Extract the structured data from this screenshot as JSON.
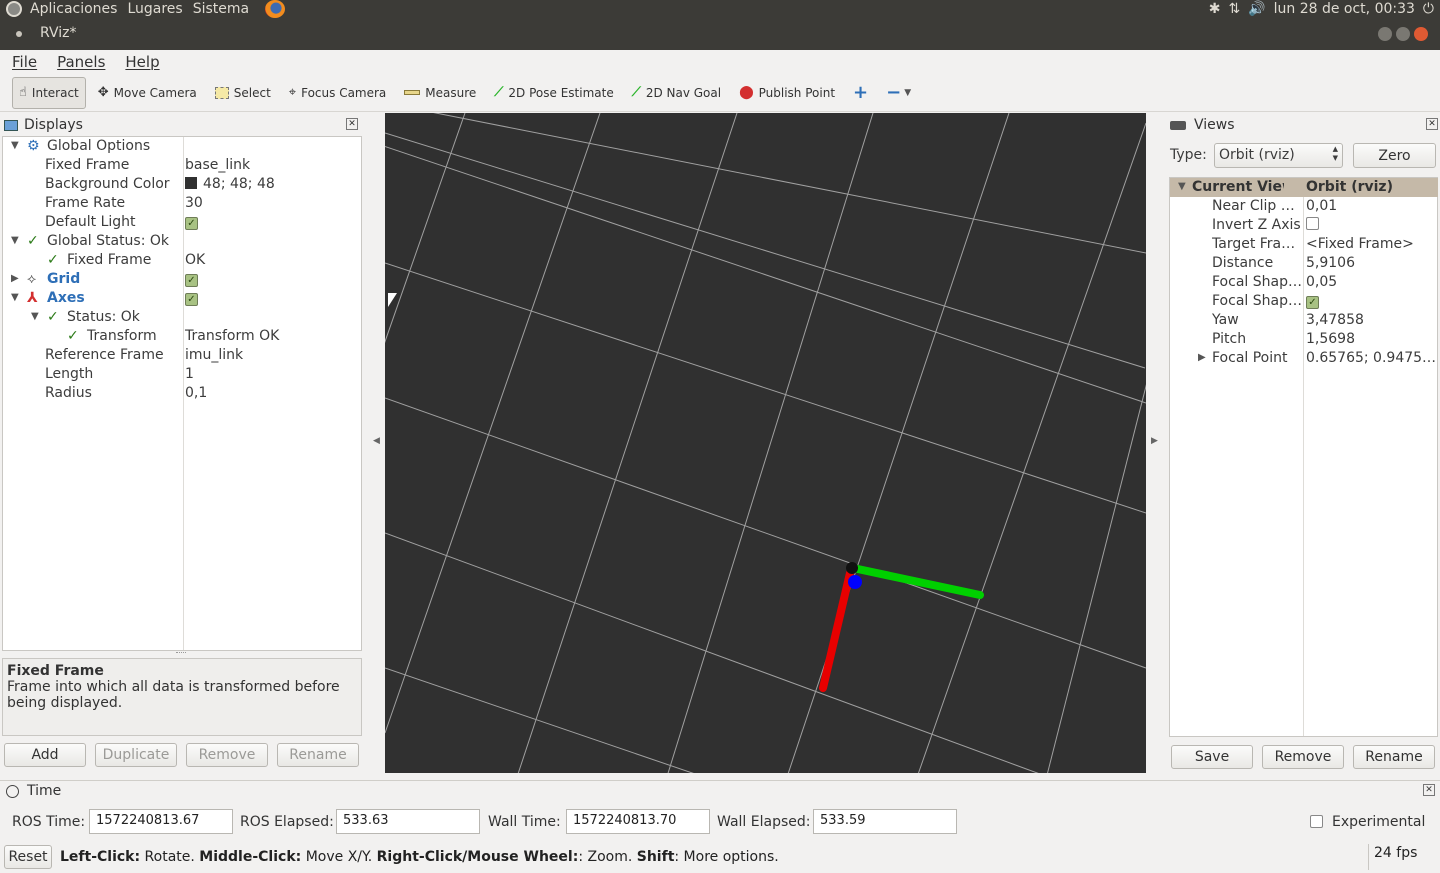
{
  "system_bar": {
    "menus": [
      "Aplicaciones",
      "Lugares",
      "Sistema"
    ],
    "clock": "lun 28 de oct, 00:33"
  },
  "window": {
    "title": "RViz*"
  },
  "menubar": [
    "File",
    "Panels",
    "Help"
  ],
  "toolbar": {
    "tools": [
      {
        "label": "Interact",
        "icon": "hand-icon"
      },
      {
        "label": "Move Camera",
        "icon": "move-camera-icon"
      },
      {
        "label": "Select",
        "icon": "select-icon"
      },
      {
        "label": "Focus Camera",
        "icon": "focus-camera-icon"
      },
      {
        "label": "Measure",
        "icon": "ruler-icon"
      },
      {
        "label": "2D Pose Estimate",
        "icon": "pose-arrow-icon"
      },
      {
        "label": "2D Nav Goal",
        "icon": "nav-goal-arrow-icon"
      },
      {
        "label": "Publish Point",
        "icon": "map-pin-icon"
      }
    ]
  },
  "displays": {
    "title": "Displays",
    "rows": {
      "global_options": "Global Options",
      "fixed_frame_label": "Fixed Frame",
      "fixed_frame_value": "base_link",
      "bg_color_label": "Background Color",
      "bg_color_value": "48; 48; 48",
      "frame_rate_label": "Frame Rate",
      "frame_rate_value": "30",
      "default_light_label": "Default Light",
      "global_status": "Global Status: Ok",
      "status_fixed_frame": "Fixed Frame",
      "status_fixed_frame_value": "OK",
      "grid": "Grid",
      "axes": "Axes",
      "axes_status": "Status: Ok",
      "transform": "Transform",
      "transform_value": "Transform OK",
      "ref_frame_label": "Reference Frame",
      "ref_frame_value": "imu_link",
      "length_label": "Length",
      "length_value": "1",
      "radius_label": "Radius",
      "radius_value": "0,1"
    },
    "help_title": "Fixed Frame",
    "help_text": "Frame into which all data is transformed before being displayed.",
    "buttons": {
      "add": "Add",
      "duplicate": "Duplicate",
      "remove": "Remove",
      "rename": "Rename"
    }
  },
  "views": {
    "title": "Views",
    "type_label": "Type:",
    "type_value": "Orbit (rviz)",
    "zero_button": "Zero",
    "header": {
      "name": "Current View",
      "value": "Orbit (rviz)"
    },
    "rows": [
      {
        "name": "Near Clip …",
        "value": "0,01"
      },
      {
        "name": "Invert Z Axis",
        "value": ""
      },
      {
        "name": "Target Fra…",
        "value": "<Fixed Frame>"
      },
      {
        "name": "Distance",
        "value": "5,9106"
      },
      {
        "name": "Focal Shap…",
        "value": "0,05"
      },
      {
        "name": "Focal Shap…",
        "value": ""
      },
      {
        "name": "Yaw",
        "value": "3,47858"
      },
      {
        "name": "Pitch",
        "value": "1,5698"
      },
      {
        "name": "Focal Point",
        "value": "0.65765; 0.9475…"
      }
    ],
    "buttons": {
      "save": "Save",
      "remove": "Remove",
      "rename": "Rename"
    }
  },
  "time": {
    "title": "Time",
    "ros_time_label": "ROS Time:",
    "ros_time": "1572240813.67",
    "ros_elapsed_label": "ROS Elapsed:",
    "ros_elapsed": "533.63",
    "wall_time_label": "Wall Time:",
    "wall_time": "1572240813.70",
    "wall_elapsed_label": "Wall Elapsed:",
    "wall_elapsed": "533.59",
    "experimental_label": "Experimental"
  },
  "statusbar": {
    "reset": "Reset",
    "hint_b1": "Left-Click:",
    "hint_t1": " Rotate. ",
    "hint_b2": "Middle-Click:",
    "hint_t2": " Move X/Y. ",
    "hint_b3": "Right-Click/Mouse Wheel:",
    "hint_t3": ": Zoom. ",
    "hint_b4": "Shift",
    "hint_t4": ": More options.",
    "fps": "24 fps"
  },
  "colors": {
    "viewport_bg": "#303030",
    "x_axis": "#ff0000",
    "y_axis": "#00ff00",
    "z_axis": "#0000ff"
  }
}
